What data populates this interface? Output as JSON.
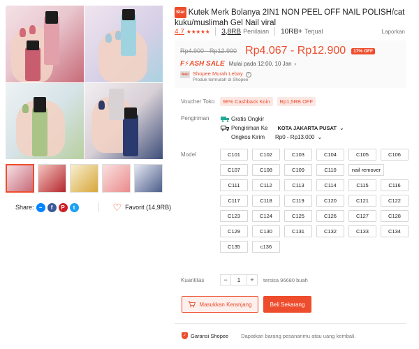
{
  "product": {
    "badge": "Star",
    "title": "Kutek Merk Bolanya 2IN1 NON PEEL OFF NAIL POLISH/cat kuku/muslimah Gel Nail viral",
    "rating": "4.7",
    "stars": "★★★★★",
    "rating_count": "3,8RB",
    "rating_count_label": "Penilaian",
    "sold": "10RB+",
    "sold_label": "Terjual",
    "report": "Laporkan"
  },
  "price": {
    "old": "Rp4.900 - Rp12.900",
    "current": "Rp4.067 - Rp12.900",
    "discount": "17% OFF"
  },
  "flash_sale": {
    "logo": "F⚡ASH SALE",
    "start": "Mulai pada 12:00, 10 Jan",
    "chevron": "›"
  },
  "mall": {
    "logo": "Mall",
    "name": "Shopee Murah Lebay",
    "sub": "Produk termurah di Shopee"
  },
  "voucher": {
    "label": "Voucher Toko",
    "items": [
      "98% Cashback Koin",
      "Rp1,5RB OFF"
    ]
  },
  "shipping": {
    "label": "Pengiriman",
    "free": "Gratis Ongkir",
    "to_label": "Pengiriman Ke",
    "to_value": "KOTA JAKARTA PUSAT",
    "cost_label": "Ongkos Kirim",
    "cost_value": "Rp0 - Rp13.000"
  },
  "model": {
    "label": "Model",
    "options": [
      "C101",
      "C102",
      "C103",
      "C104",
      "C105",
      "C106",
      "C107",
      "C108",
      "C109",
      "C110",
      "nail remover",
      "C111",
      "C112",
      "C113",
      "C114",
      "C115",
      "C116",
      "C117",
      "C118",
      "C119",
      "C120",
      "C121",
      "C122",
      "C123",
      "C124",
      "C125",
      "C126",
      "C127",
      "C128",
      "C129",
      "C130",
      "C131",
      "C132",
      "C133",
      "C134",
      "C135",
      "c136"
    ]
  },
  "quantity": {
    "label": "Kuantitas",
    "value": "1",
    "minus": "−",
    "plus": "+",
    "stock": "tersisa 96680 buah"
  },
  "actions": {
    "cart": "Masukkan Keranjang",
    "buy": "Beli Sekarang"
  },
  "guarantee": {
    "title": "Garansi Shopee",
    "desc": "Dapatkan barang pesananmu atau uang kembali."
  },
  "share": {
    "label": "Share:",
    "favorite": "Favorit (14,9RB)"
  },
  "colors": {
    "accent": "#ee4d2d"
  }
}
